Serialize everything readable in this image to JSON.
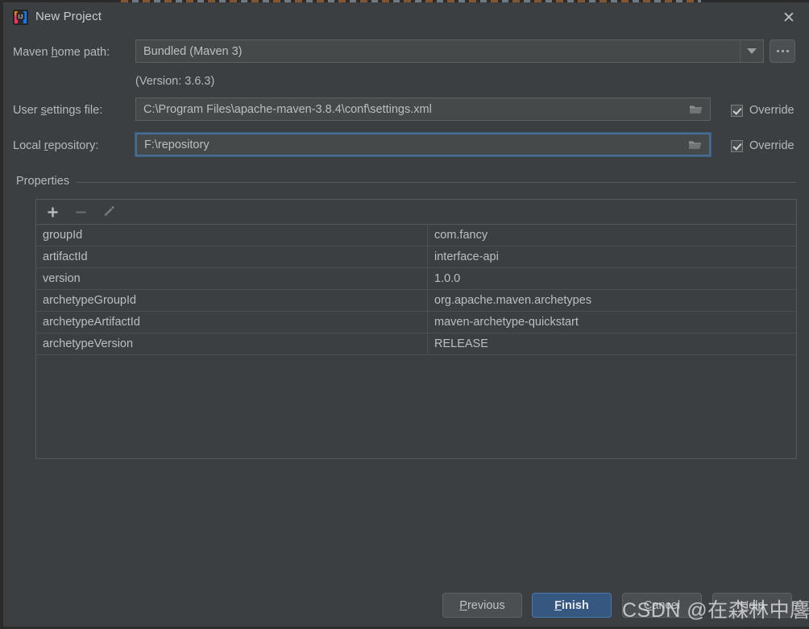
{
  "window": {
    "title": "New Project",
    "app_icon": "intellij-idea-icon",
    "close_label": "✕"
  },
  "form": {
    "maven_home": {
      "label_pre": "Maven ",
      "label_mnemonic": "h",
      "label_post": "ome path:",
      "value": "Bundled (Maven 3)",
      "dropdown_icon": "chevron-down-icon",
      "browse_label": "...",
      "version_note": "(Version: 3.6.3)"
    },
    "user_settings": {
      "label_pre": "User ",
      "label_mnemonic": "s",
      "label_post": "ettings file:",
      "value": "C:\\Program Files\\apache-maven-3.8.4\\conf\\settings.xml",
      "folder_icon": "folder-icon",
      "override_label": "Override",
      "override_checked": true
    },
    "local_repository": {
      "label_pre": "Local ",
      "label_mnemonic": "r",
      "label_post": "epository:",
      "value": "F:\\repository",
      "folder_icon": "folder-icon",
      "override_label": "Override",
      "override_checked": true,
      "focused": true
    }
  },
  "properties": {
    "group_label": "Properties",
    "toolbar": {
      "add_icon": "plus-icon",
      "remove_icon": "minus-icon",
      "edit_icon": "pencil-icon"
    },
    "rows": [
      {
        "key": "groupId",
        "value": "com.fancy"
      },
      {
        "key": "artifactId",
        "value": "interface-api"
      },
      {
        "key": "version",
        "value": "1.0.0"
      },
      {
        "key": "archetypeGroupId",
        "value": "org.apache.maven.archetypes"
      },
      {
        "key": "archetypeArtifactId",
        "value": "maven-archetype-quickstart"
      },
      {
        "key": "archetypeVersion",
        "value": "RELEASE"
      }
    ]
  },
  "footer": {
    "previous": {
      "pre": "",
      "mn": "P",
      "post": "revious"
    },
    "finish": {
      "pre": "",
      "mn": "F",
      "post": "inish"
    },
    "cancel": {
      "pre": "",
      "mn": "C",
      "post": "ancel"
    },
    "help": {
      "pre": "",
      "mn": "H",
      "post": "elp"
    }
  },
  "watermark": {
    "text": "CSDN @在森林中麐了鹿"
  },
  "colors": {
    "dialog_bg": "#3c3f41",
    "field_bg": "#45494a",
    "focus_border": "#466d94",
    "primary_button": "#365880",
    "text": "#bcbfc1"
  }
}
